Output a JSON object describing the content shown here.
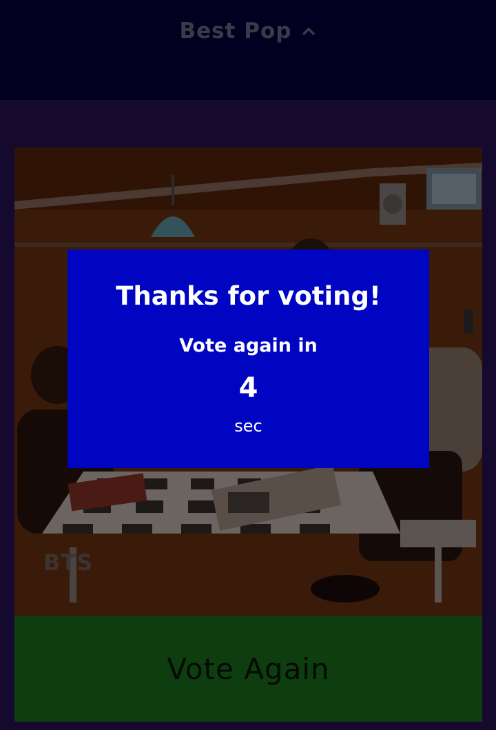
{
  "header": {
    "category_label": "Best Pop",
    "toggle_icon": "chevron-up-icon"
  },
  "nominee": {
    "artist_name": "BTS"
  },
  "vote_button": {
    "label": "Vote Again"
  },
  "modal": {
    "title": "Thanks for voting!",
    "subtitle": "Vote again in",
    "countdown": "4",
    "unit": "sec"
  },
  "colors": {
    "header_bg": "#020020",
    "page_bg": "#150a2e",
    "modal_bg": "#0005c2",
    "vote_button_bg": "#0e3d10"
  }
}
